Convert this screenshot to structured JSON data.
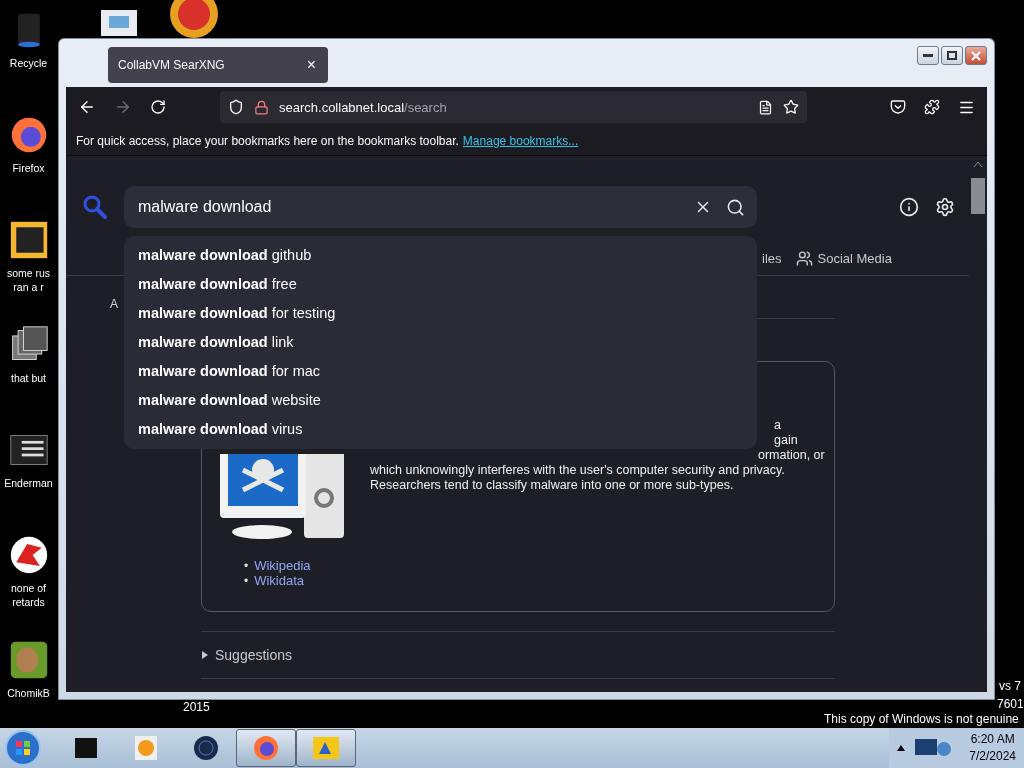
{
  "desktop": {
    "icons": [
      {
        "label": "Recycle"
      },
      {
        "label": "Firefox"
      },
      {
        "label": "some rus\nran a r"
      },
      {
        "label": "that but"
      },
      {
        "label": "Enderman"
      },
      {
        "label": "none of\nretards"
      },
      {
        "label": "ChomikB"
      }
    ],
    "watermark_lines": [
      "2015",
      "vs 7",
      "7601",
      "This copy of Windows is not genuine"
    ]
  },
  "browser": {
    "tab": {
      "title": "CollabVM SearXNG",
      "close": "×"
    },
    "url": {
      "host": "search.collabnet.local",
      "path": "/search"
    },
    "bookmarks_bar": {
      "text": "For quick access, place your bookmarks here on the bookmarks toolbar.",
      "link": "Manage bookmarks..."
    }
  },
  "search": {
    "value": "malware download",
    "suggestions": [
      {
        "text": "**malware download** github"
      },
      {
        "text": "**malware download** free"
      },
      {
        "text": "**malware download** for testing"
      },
      {
        "text": "**malware download** link"
      },
      {
        "text": "**malware download** for mac"
      },
      {
        "text": "**malware download** website"
      },
      {
        "text": "**malware download** virus"
      }
    ],
    "categories": [
      {
        "label": "iles"
      },
      {
        "label": "Social Media"
      }
    ],
    "cut_label": "A"
  },
  "infobox": {
    "partial_lines": [
      "a",
      "gain",
      "ormation, or"
    ],
    "lines": [
      "which unknowingly interferes with the user's computer security and privacy.",
      "Researchers tend to classify malware into one or more sub-types."
    ],
    "bullet": "•",
    "links": [
      "Wikipedia",
      "Wikidata"
    ]
  },
  "suggestions_section": {
    "label": "Suggestions",
    "expanded": false
  },
  "taskbar": {
    "items": [
      {
        "active": false
      },
      {
        "active": false
      },
      {
        "active": false
      },
      {
        "active": true
      },
      {
        "active": true
      }
    ],
    "time": "6:20 AM",
    "date": "7/2/2024"
  }
}
